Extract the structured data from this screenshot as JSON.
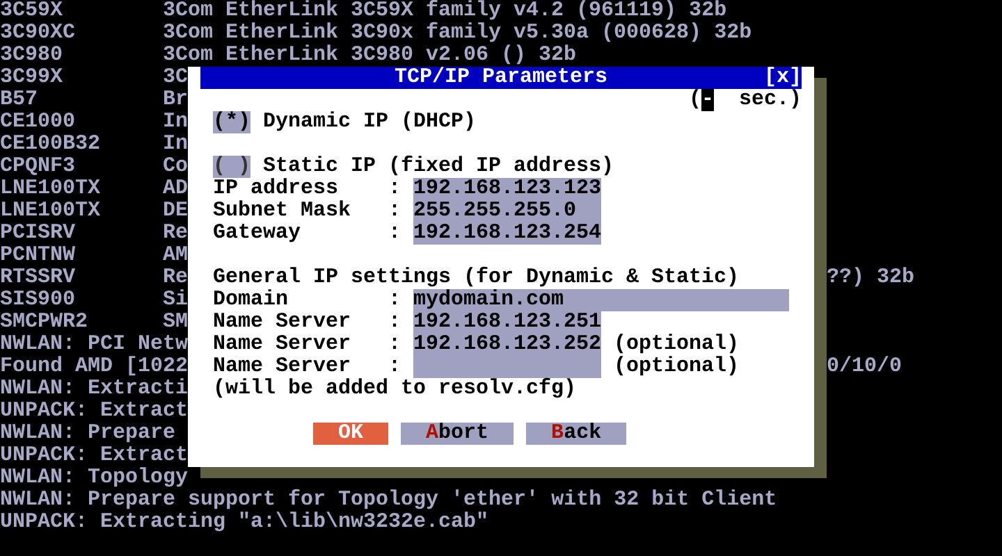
{
  "console_lines": [
    {
      "left": "3C59X",
      "description": "3Com EtherLink 3C59X family v4.2 (961119) 32b"
    },
    {
      "left": "3C90XC",
      "description": "3Com EtherLink 3C90x family v5.30a (000628) 32b"
    },
    {
      "left": "3C980",
      "description": "3Com EtherLink 3C980 v2.06 () 32b"
    },
    {
      "left": "3C99X",
      "description": "3C"
    },
    {
      "left": "B57",
      "description": "Br"
    },
    {
      "left": "CE1000",
      "description": "In"
    },
    {
      "left": "CE100B32",
      "description": "In"
    },
    {
      "left": "CPQNF3",
      "description": "Co"
    },
    {
      "left": "LNE100TX",
      "description": "AD"
    },
    {
      "left": "LNE100TX",
      "description": "DE"
    },
    {
      "left": "PCISRV",
      "description": "Re"
    },
    {
      "left": "PCNTNW",
      "description": "AM"
    },
    {
      "left": "RTSSRV",
      "description": "Re",
      "tail": "??) 32b"
    },
    {
      "left": "SIS900",
      "description": "Si"
    },
    {
      "left": "SMCPWR2",
      "description": "SM"
    },
    {
      "left": "NWLAN: PCI Netw"
    },
    {
      "left": "Found AMD [1022",
      "tail": "0/10/0"
    },
    {
      "left": "NWLAN: Extracti"
    },
    {
      "left": "UNPACK: Extract"
    },
    {
      "left": "NWLAN: Prepare"
    },
    {
      "left": "UNPACK: Extract"
    },
    {
      "left": "NWLAN: Topology"
    },
    {
      "left": "NWLAN: Prepare support for Topology 'ether' with 32 bit Client"
    },
    {
      "left": "UNPACK: Extracting \"a:\\lib\\nw3232e.cab\""
    }
  ],
  "dialog": {
    "title": "TCP/IP Parameters",
    "close": "[x]",
    "timeout": {
      "open": "(",
      "cursor": "-",
      "text": "sec.)"
    },
    "modes": [
      {
        "marker": "(*)",
        "label": "Dynamic IP (DHCP)",
        "selected": true
      },
      {
        "marker": "( )",
        "label": "Static IP (fixed IP address)",
        "selected": false
      }
    ],
    "static_fields": [
      {
        "label": "IP address",
        "separator": ":",
        "kind": "ip",
        "value": "192.168.123.123"
      },
      {
        "label": "Subnet Mask",
        "separator": ":",
        "kind": "ip",
        "value": "255.255.255.0"
      },
      {
        "label": "Gateway",
        "separator": ":",
        "kind": "ip",
        "value": "192.168.123.254"
      }
    ],
    "general_heading": "General IP settings (for Dynamic & Static)",
    "general_fields": [
      {
        "label": "Domain",
        "separator": ":",
        "kind": "wide",
        "value": "mydomain.com"
      },
      {
        "label": "Name Server",
        "separator": ":",
        "kind": "ip",
        "value": "192.168.123.251"
      },
      {
        "label": "Name Server",
        "separator": ":",
        "kind": "ip",
        "value": "192.168.123.252",
        "note": "(optional)"
      },
      {
        "label": "Name Server",
        "separator": ":",
        "kind": "ip",
        "note": "(optional)"
      }
    ],
    "note": "(will be added to resolv.cfg)",
    "buttons": [
      {
        "label": "OK",
        "default": true
      },
      {
        "hotkey": "A",
        "label": "bort",
        "default": false
      },
      {
        "hotkey": "B",
        "label": "ack",
        "default": false
      }
    ]
  }
}
